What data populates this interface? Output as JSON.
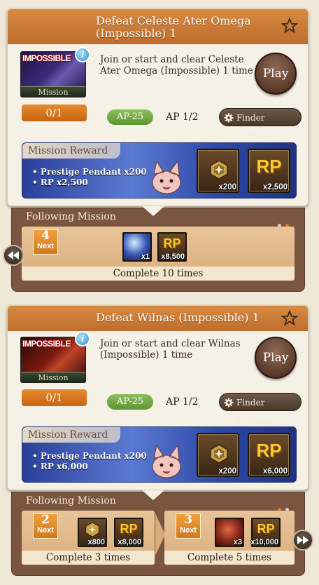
{
  "missions": [
    {
      "title_line1": "Defeat Celeste Ater Omega",
      "title_line2": "(Impossible) 1",
      "thumb_badge": "IMPOSSIBLE",
      "thumb_label": "Mission",
      "description": "Join or start and clear Celeste Ater Omega (Impossible) 1 time",
      "play_label": "Play",
      "progress": "0/1",
      "ap_cost": "AP-25",
      "ap_value": "AP 1/2",
      "finder_label": "Finder Settings",
      "reward_title": "Mission Reward",
      "reward_lines": [
        "• Prestige Pendant x200",
        "• RP x2,500"
      ],
      "reward_icons": [
        {
          "icon": "prestige-pendant-icon",
          "qty": "x200"
        },
        {
          "icon": "rp-icon",
          "label": "RP",
          "qty": "x2,500"
        }
      ],
      "following": {
        "title": "Following Mission",
        "steps": [
          {
            "next_num": "4",
            "next_label": "Next",
            "icons": [
              {
                "icon": "crystal-orb-icon",
                "qty": "x1"
              },
              {
                "icon": "rp-icon",
                "label": "RP",
                "qty": "x8,500"
              }
            ],
            "complete_text": "Complete 10 times"
          }
        ]
      }
    },
    {
      "title_line1": "Defeat Wilnas (Impossible) 1",
      "thumb_badge": "IMPOSSIBLE",
      "thumb_label": "Mission",
      "description": "Join or start and clear Wilnas (Impossible) 1 time",
      "play_label": "Play",
      "progress": "0/1",
      "ap_cost": "AP-25",
      "ap_value": "AP 1/2",
      "finder_label": "Finder Settings",
      "reward_title": "Mission Reward",
      "reward_lines": [
        "• Prestige Pendant x200",
        "• RP x6,000"
      ],
      "reward_icons": [
        {
          "icon": "prestige-pendant-icon",
          "qty": "x200"
        },
        {
          "icon": "rp-icon",
          "label": "RP",
          "qty": "x6,000"
        }
      ],
      "following": {
        "title": "Following Mission",
        "steps": [
          {
            "next_num": "2",
            "next_label": "Next",
            "icons": [
              {
                "icon": "prestige-pendant-icon",
                "qty": "x800"
              },
              {
                "icon": "rp-icon",
                "label": "RP",
                "qty": "x8,000"
              }
            ],
            "complete_text": "Complete 3 times"
          },
          {
            "next_num": "3",
            "next_label": "Next",
            "icons": [
              {
                "icon": "dragon-scale-icon",
                "qty": "x3"
              },
              {
                "icon": "rp-icon",
                "label": "RP",
                "qty": "x10,000"
              }
            ],
            "complete_text": "Complete 5 times"
          }
        ]
      }
    }
  ],
  "colors": {
    "header": "#c97a36",
    "ap_badge": "#6fa641",
    "progress": "#d9761f",
    "reward_bg": "#3a56b8",
    "dot_active": "#e0782a",
    "dot_inactive": "#d8cfc0"
  }
}
